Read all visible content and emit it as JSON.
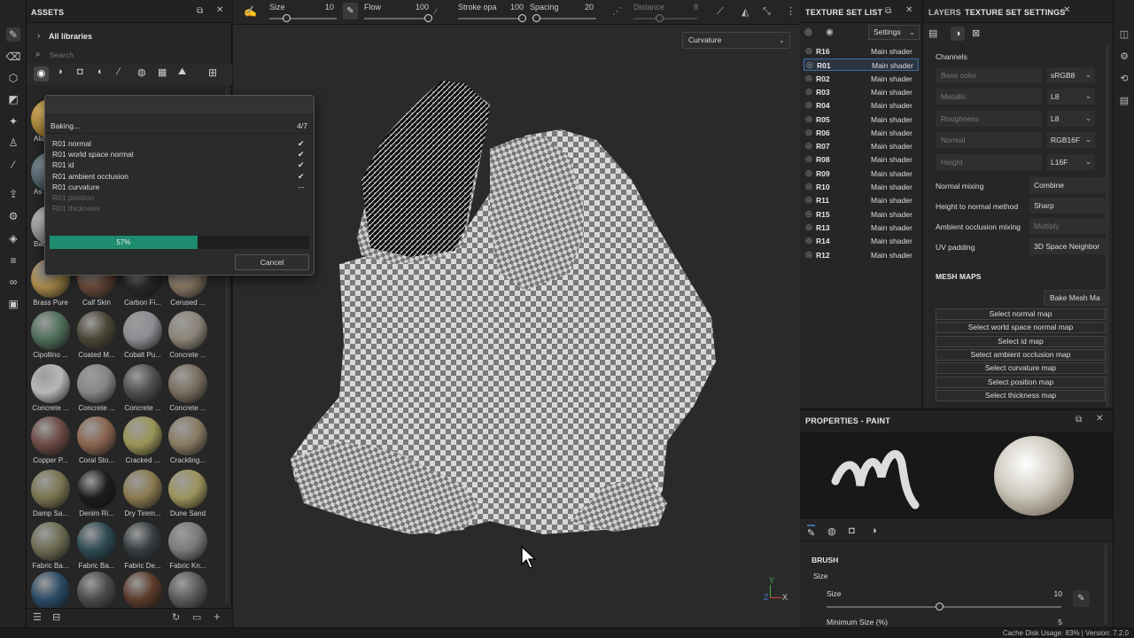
{
  "assets": {
    "title": "ASSETS",
    "library": "All libraries",
    "search_placeholder": "Search",
    "partial_labels": [
      "Alu",
      "As",
      "Bat"
    ],
    "materials": [
      {
        "label": "Brass Pure",
        "color": "#a88a4a"
      },
      {
        "label": "Calf Skin",
        "color": "#6a4a3a"
      },
      {
        "label": "Carbon Fi...",
        "color": "#2a2a2a"
      },
      {
        "label": "Cerused ...",
        "color": "#8a7a66"
      },
      {
        "label": "Cipollino ...",
        "color": "#4f6e5a"
      },
      {
        "label": "Coated M...",
        "color": "#4a4636"
      },
      {
        "label": "Cobalt Pu...",
        "color": "#8a8c90"
      },
      {
        "label": "Concrete ...",
        "color": "#8c8478"
      },
      {
        "label": "Concrete ...",
        "color": "#b6b6b6"
      },
      {
        "label": "Concrete ...",
        "color": "#858784"
      },
      {
        "label": "Concrete ...",
        "color": "#4d4f50"
      },
      {
        "label": "Concrete ...",
        "color": "#7a6e5e"
      },
      {
        "label": "Copper P...",
        "color": "#6b4a44"
      },
      {
        "label": "Coral Sto...",
        "color": "#8a6450"
      },
      {
        "label": "Cracked ...",
        "color": "#9a9458"
      },
      {
        "label": "Crackling...",
        "color": "#8a7a62"
      },
      {
        "label": "Damp Sa...",
        "color": "#7a7450"
      },
      {
        "label": "Denim Ri...",
        "color": "#1c1c1c"
      },
      {
        "label": "Dry Tirem...",
        "color": "#8a7a50"
      },
      {
        "label": "Dune Sand",
        "color": "#9c945c"
      },
      {
        "label": "Fabric Ba...",
        "color": "#6c6c52"
      },
      {
        "label": "Fabric Ba...",
        "color": "#2e4a54"
      },
      {
        "label": "Fabric De...",
        "color": "#363c40"
      },
      {
        "label": "Fabric Kn...",
        "color": "#7a7a7a"
      },
      {
        "label": "",
        "color": "#2a4a64"
      },
      {
        "label": "",
        "color": "#4a4a4a"
      },
      {
        "label": "",
        "color": "#5a3a2a"
      },
      {
        "label": "",
        "color": "#5a5a5a"
      }
    ]
  },
  "topbar": {
    "size_label": "Size",
    "size_value": "10",
    "size_frac": 0.25,
    "flow_label": "Flow",
    "flow_value": "100",
    "flow_frac": 1.0,
    "stroke_label": "Stroke opa",
    "stroke_value": "100",
    "stroke_frac": 1.0,
    "spacing_label": "Spacing",
    "spacing_value": "20",
    "spacing_frac": 0.05,
    "distance_label": "Distance",
    "distance_value": "8",
    "distance_frac": 0.4
  },
  "viewport": {
    "channel_select": "Curvature"
  },
  "bake_dialog": {
    "title": "Baking...",
    "progress_text": "4/7",
    "progress_percent": 57,
    "progress_label": "57%",
    "items": [
      {
        "label": "R01 normal",
        "status": "done"
      },
      {
        "label": "R01 world space normal",
        "status": "done"
      },
      {
        "label": "R01 id",
        "status": "done"
      },
      {
        "label": "R01 ambient occlusion",
        "status": "done"
      },
      {
        "label": "R01 curvature",
        "status": "running"
      },
      {
        "label": "R01 position",
        "status": "pending"
      },
      {
        "label": "R01 thickness",
        "status": "pending"
      }
    ],
    "done_glyph": "✔",
    "running_glyph": "...",
    "cancel_label": "Cancel"
  },
  "texture_set_list": {
    "title": "TEXTURE SET LIST",
    "settings_label": "Settings",
    "rows": [
      {
        "name": "R16",
        "shader": "Main shader"
      },
      {
        "name": "R01",
        "shader": "Main shader",
        "selected": true
      },
      {
        "name": "R02",
        "shader": "Main shader"
      },
      {
        "name": "R03",
        "shader": "Main shader"
      },
      {
        "name": "R04",
        "shader": "Main shader"
      },
      {
        "name": "R05",
        "shader": "Main shader"
      },
      {
        "name": "R06",
        "shader": "Main shader"
      },
      {
        "name": "R07",
        "shader": "Main shader"
      },
      {
        "name": "R08",
        "shader": "Main shader"
      },
      {
        "name": "R09",
        "shader": "Main shader"
      },
      {
        "name": "R10",
        "shader": "Main shader"
      },
      {
        "name": "R11",
        "shader": "Main shader"
      },
      {
        "name": "R15",
        "shader": "Main shader"
      },
      {
        "name": "R13",
        "shader": "Main shader"
      },
      {
        "name": "R14",
        "shader": "Main shader"
      },
      {
        "name": "R12",
        "shader": "Main shader"
      }
    ]
  },
  "texture_set_settings": {
    "tab_layers": "LAYERS",
    "tab_settings": "TEXTURE SET SETTINGS",
    "channels_heading": "Channels",
    "channels": [
      {
        "name": "Base color",
        "format": "sRGB8"
      },
      {
        "name": "Metallic",
        "format": "L8"
      },
      {
        "name": "Roughness",
        "format": "L8"
      },
      {
        "name": "Normal",
        "format": "RGB16F"
      },
      {
        "name": "Height",
        "format": "L16F"
      }
    ],
    "options": [
      {
        "label": "Normal mixing",
        "value": "Combine"
      },
      {
        "label": "Height to normal method",
        "value": "Sharp"
      },
      {
        "label": "Ambient occlusion mixing",
        "value": "Multiply",
        "disabled": true
      },
      {
        "label": "UV padding",
        "value": "3D Space Neighbor"
      }
    ],
    "mesh_maps_heading": "MESH MAPS",
    "bake_button": "Bake Mesh Ma",
    "map_buttons": [
      "Select normal map",
      "Select world space normal map",
      "Select id map",
      "Select ambient occlusion map",
      "Select curvature map",
      "Select position map",
      "Select thickness map"
    ]
  },
  "properties": {
    "title": "PROPERTIES - PAINT",
    "brush_heading": "BRUSH",
    "size_group": "Size",
    "size_label": "Size",
    "size_value": "10",
    "size_frac": 0.48,
    "min_size_label": "Minimum Size (%)",
    "min_size_value": "5"
  },
  "status": {
    "text": "Cache Disk Usage:  83% | Version: 7.2.0"
  },
  "colors": {
    "accent_green": "#1e8c6e",
    "selection_blue": "#3a6ea8"
  }
}
